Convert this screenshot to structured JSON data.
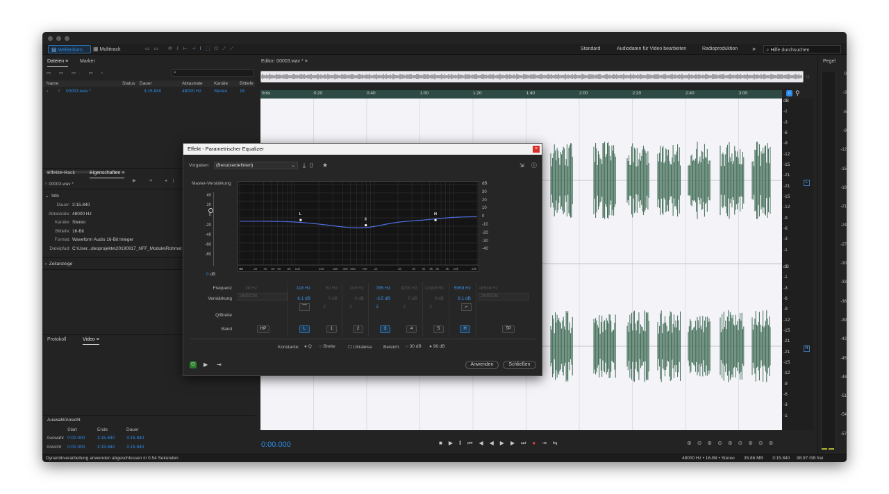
{
  "toolbar": {
    "waveform": "Wellenform",
    "multitrack": "Multitrack",
    "workspaces": [
      "Standard",
      "Audiodaten für Video bearbeiten",
      "Radioproduktion"
    ],
    "more": "»",
    "search_placeholder": "Hilfe durchsuchen"
  },
  "files": {
    "tabs": [
      "Dateien",
      "Marker"
    ],
    "columns": [
      "Name",
      "Status",
      "Dauer",
      "Abtastrate",
      "Kanäle",
      "Bittiefe"
    ],
    "row": {
      "name": "00003.wav *",
      "status": "",
      "dauer": "3:15.840",
      "rate": "48000 Hz",
      "kanaele": "Stereo",
      "bits": "16"
    }
  },
  "props": {
    "tabs": [
      "Effekte-Rack",
      "Eigenschaften"
    ],
    "file": "00003.wav *",
    "info_title": "Info",
    "info": [
      {
        "k": "Dauer:",
        "v": "3:15.840"
      },
      {
        "k": "Abtastrate:",
        "v": "48000 Hz"
      },
      {
        "k": "Kanäle:",
        "v": "Stereo"
      },
      {
        "k": "Bittiefe:",
        "v": "16-Bit"
      },
      {
        "k": "Format:",
        "v": "Waveform Audio 16-Bit Integer"
      },
      {
        "k": "Dateipfad:",
        "v": "C:\\User...deoprojekte\\20190917_NFF_Module\\Rohmat"
      }
    ],
    "zeit": "Zeitanzeige"
  },
  "lowtabs": [
    "Protokoll",
    "Video"
  ],
  "selection": {
    "title": "Auswahl/Ansicht",
    "headers": [
      "Start",
      "Ende",
      "Dauer"
    ],
    "rows": [
      {
        "label": "Auswahl",
        "start": "0:00.000",
        "end": "3:15.840",
        "dur": "3:15.840"
      },
      {
        "label": "Ansicht",
        "start": "0:00.000",
        "end": "3:15.840",
        "dur": "3:15.840"
      }
    ]
  },
  "status": {
    "left": "Dynamikverarbeitung anwenden abgeschlossen in 0.54 Sekunden",
    "right": [
      "48000 Hz • 16-Bit • Stereo",
      "35.86 MB",
      "3:15.840",
      "98.97 GB frei"
    ]
  },
  "editor": {
    "tab": "Editor: 00003.wav *",
    "time": "0:00.000",
    "ruler": [
      "hms",
      "0:20",
      "0:40",
      "1:00",
      "1:20",
      "1:40",
      "2:00",
      "2:20",
      "2:40",
      "3:00"
    ],
    "db_top": [
      "dB",
      "-1",
      "-3",
      "-6",
      "-9",
      "-12",
      "-15",
      "-21",
      "-21",
      "-15",
      "-12",
      "-9",
      "-6",
      "-3",
      "-1"
    ],
    "db_bottom": [
      "dB",
      "-1",
      "-3",
      "-6",
      "-9",
      "-12",
      "-15",
      "-21",
      "-21",
      "-15",
      "-12",
      "-9",
      "-6",
      "-3",
      "-1"
    ],
    "ch_l": "L",
    "ch_r": "R"
  },
  "meter": {
    "title": "Pegel",
    "scale": [
      "0",
      "-3",
      "-6",
      "-9",
      "-12",
      "-15",
      "-18",
      "-21",
      "-24",
      "-27",
      "-30",
      "-33",
      "-36",
      "-39",
      "-42",
      "-45",
      "-48",
      "-51",
      "-54",
      "-57"
    ]
  },
  "dialog": {
    "title": "Effekt - Parametrischer Equalizer",
    "presets_label": "Vorgaben:",
    "preset": "(Benutzerdefiniert)",
    "master_label": "Master-Verstärkung",
    "master_value": "0",
    "master_unit": "dB",
    "left_scale": [
      "40",
      "20",
      "0",
      "-20",
      "-40",
      "-60",
      "-80"
    ],
    "right_scale": [
      "dB",
      "30",
      "20",
      "10",
      "0",
      "-10",
      "-20",
      "-30",
      "-40"
    ],
    "freq_axis": [
      "Hz",
      "20",
      "30",
      "40",
      "50",
      "60",
      "80",
      "100",
      "200",
      "300",
      "400",
      "500",
      "700",
      "1k",
      "2k",
      "3k",
      "4k",
      "5k",
      "6k",
      "8k",
      "10k",
      "20k"
    ],
    "point_labels": [
      "L",
      "3",
      "H"
    ],
    "row_labels": [
      "Frequenz",
      "Verstärkung",
      "Q/Breite",
      "Band"
    ],
    "freqs": [
      "38 Hz",
      "118 Hz",
      "50 Hz",
      "200 Hz",
      "785 Hz",
      "3200 Hz",
      "12800 Hz",
      "5959 Hz",
      "16538 Hz"
    ],
    "gains": [
      "24dB/Okt",
      "6.1 dB",
      "0 dB",
      "0 dB",
      "-3.5 dB",
      "0 dB",
      "0 dB",
      "8.1 dB",
      "24dB/Okt"
    ],
    "qs": [
      "2",
      "2",
      "2",
      "2",
      "2"
    ],
    "bands": [
      "HP",
      "L",
      "1",
      "2",
      "3",
      "4",
      "5",
      "H",
      "TP"
    ],
    "const_label": "Konstante:",
    "q": "Q",
    "breite": "Breite",
    "ultra": "Ultraleise",
    "bereich": "Bereich:",
    "r30": "30 dB",
    "r96": "96 dB",
    "apply": "Anwenden",
    "close": "Schließen"
  },
  "colors": {
    "accent": "#2d8ceb",
    "wave": "#3e6a53",
    "eq_curve": "#4f6fe8"
  }
}
